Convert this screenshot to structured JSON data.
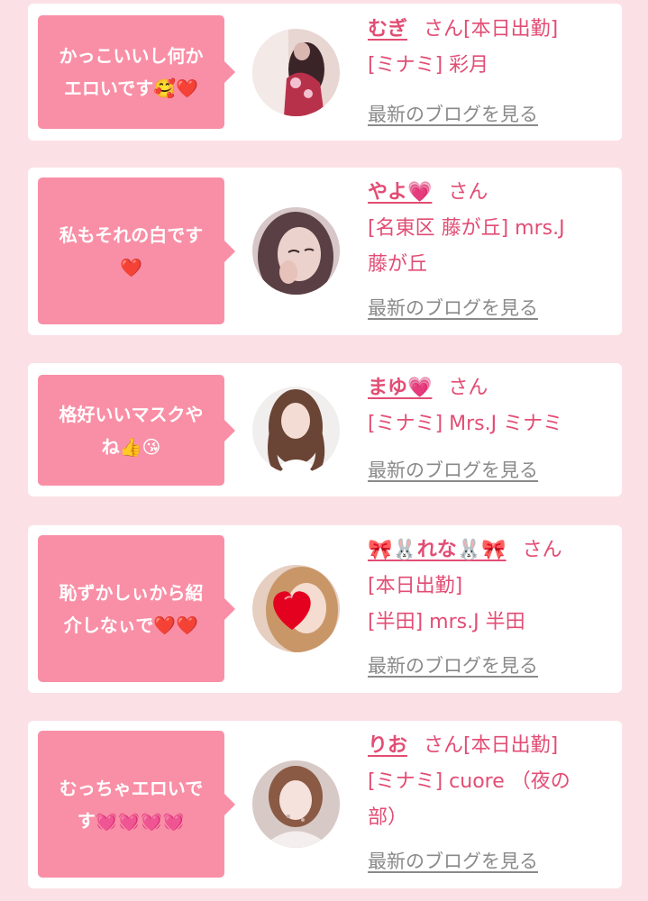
{
  "blog_link_label": "最新のブログを見る",
  "honorific": "さん",
  "cards": [
    {
      "comment": "かっこいいし何かエロいです🥰❤️",
      "name": "むぎ",
      "lines": [
        "[本日出勤]",
        "[ミナミ] 彩月"
      ]
    },
    {
      "comment": "私もそれの白です❤️",
      "name": "やよ💗",
      "lines": [
        "[名東区 藤が丘] mrs.J",
        "藤が丘"
      ]
    },
    {
      "comment": "格好いいマスクやね👍😘",
      "name": "まゆ💗",
      "lines": [
        "[ミナミ] Mrs.J ミナミ"
      ]
    },
    {
      "comment": "恥ずかしぃから紹介しなぃで❤️❤️",
      "name": "🎀🐰れな🐰🎀",
      "lines": [
        "[本日出勤]",
        "[半田] mrs.J 半田"
      ]
    },
    {
      "comment": "むっちゃエロいです💓💓💓💓",
      "name": "りお",
      "lines": [
        "[本日出勤]",
        "[ミナミ] cuore （夜の",
        "部）"
      ]
    }
  ],
  "colors": {
    "page_background": "#fbe1e6",
    "bubble": "#f98fa6",
    "name": "#e24d74",
    "link": "#8a8a8a"
  }
}
